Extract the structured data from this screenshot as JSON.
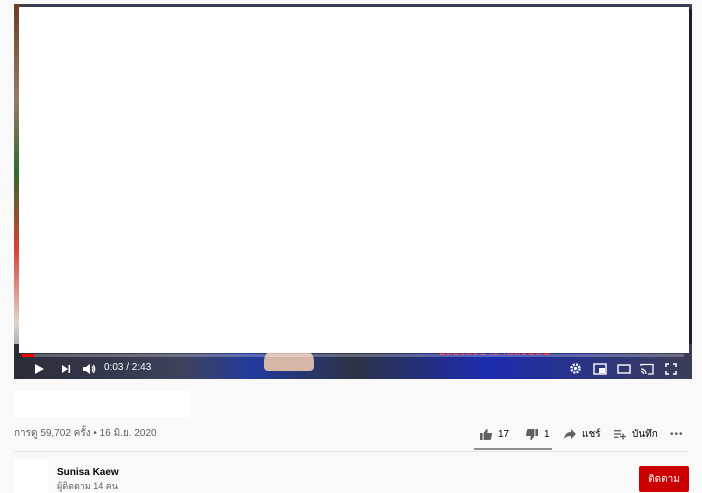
{
  "player": {
    "time_display": "0:03 / 2:43",
    "progress_fraction": 0.018,
    "subtitle_text": "ฉลองสะบายาบตะแหน"
  },
  "video": {
    "view_info": "การดู 59,702 ครั้ง • 16 มิ.ย. 2020",
    "likes": "17",
    "dislikes": "1",
    "share_label": "แชร์",
    "save_label": "บันทึก",
    "more_label": "•••"
  },
  "channel": {
    "name": "Sunisa Kaew",
    "subscribers": "ผู้ติดตาม 14 คน",
    "subscribe_label": "ติดตาม"
  },
  "colors": {
    "accent_red": "#ff0000",
    "subscribe_red": "#cc0000"
  }
}
